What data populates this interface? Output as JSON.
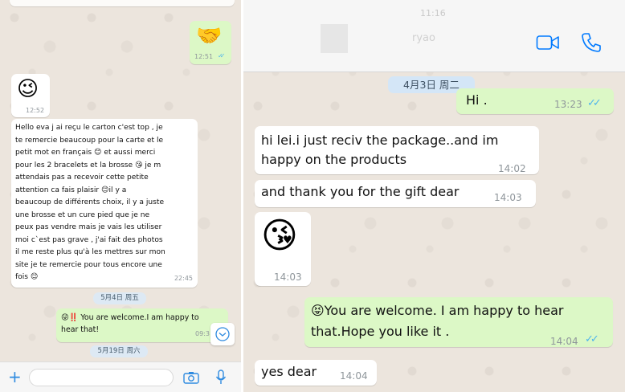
{
  "left": {
    "messages": [
      {
        "emoji": "🤝",
        "time": "12:51",
        "check": "✓✓"
      },
      {
        "emoji": "😉",
        "time": "12:52"
      },
      {
        "lines": [
          "Hello eva j ai reçu le carton c'est top , je",
          "te remercie beaucoup pour la carte et le",
          "petit mot en français 😊 et aussi merci",
          "pour les 2 bracelets et la brosse 😘 je m",
          "attendais pas a recevoir cette petite",
          "attention ca fais plaisir 😊il y  a",
          "beaucoup de différents choix,  il y a juste",
          "une brosse et un cure pied que je ne",
          "peux pas vendre mais je vais les utiliser",
          "moi c`est pas grave , j'ai fait des photos",
          "il me reste plus qu'à les mettres sur mon",
          "site je te remercie pour tous encore une",
          "fois 😊"
        ],
        "time": "22:45"
      },
      {
        "lines": [
          "😜‼️ You are welcome.I am happy to",
          "hear that!"
        ],
        "time": "09:3"
      }
    ],
    "dates": [
      "5月4日 周五",
      "5月19日 周六"
    ],
    "input": {
      "placeholder": ""
    },
    "icons": {
      "plus": "+",
      "camera": "📷",
      "mic": "🎙",
      "scroll_down": "⌄"
    }
  },
  "right": {
    "header": {
      "time_partial": "11:16",
      "name_partial": "ryao"
    },
    "date": "4月3日 周二",
    "messages": [
      {
        "text": "Hi .",
        "time": "13:23",
        "check": "✓✓"
      },
      {
        "lines": [
          "hi lei.i just reciv the package..and im",
          "happy on the products"
        ],
        "time": "14:02"
      },
      {
        "text": "and thank you for the gift dear",
        "time": "14:03"
      },
      {
        "emoji": "😘",
        "time": "14:03"
      },
      {
        "lines": [
          "😝You are welcome. I am happy to hear",
          "that.Hope you like it ."
        ],
        "time": "14:04",
        "check": "✓✓"
      },
      {
        "text": "yes dear",
        "time": "14:04"
      }
    ],
    "icons": {
      "video": "video-call",
      "phone": "voice-call"
    },
    "colors": {
      "accent": "#007aff",
      "outgoing": "#dcf8c6",
      "incoming": "#ffffff",
      "date_chip": "#d4e6f7"
    }
  }
}
